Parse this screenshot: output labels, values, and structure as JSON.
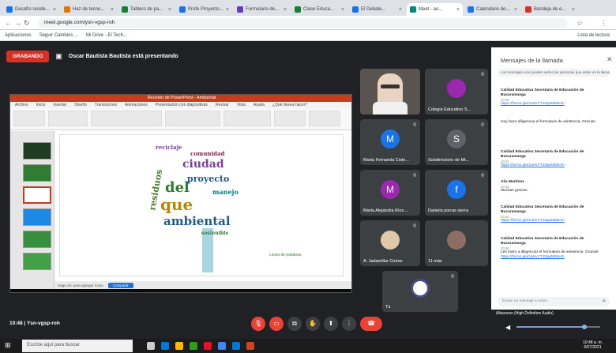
{
  "browser": {
    "tabs": [
      {
        "label": "Desafío reside...",
        "color": "#1a73e8"
      },
      {
        "label": "Haz de tecno...",
        "color": "#e37400"
      },
      {
        "label": "Tablero de pa...",
        "color": "#188038"
      },
      {
        "label": "Profe Proyecto...",
        "color": "#1a73e8"
      },
      {
        "label": "Formulario de...",
        "color": "#673ab7"
      },
      {
        "label": "Clase Educa...",
        "color": "#188038"
      },
      {
        "label": "El Debate...",
        "color": "#1a73e8"
      },
      {
        "label": "Meet - ao...",
        "color": "#00897b"
      },
      {
        "label": "Calendario de...",
        "color": "#1a73e8"
      },
      {
        "label": "Bandeja de e...",
        "color": "#d93025"
      }
    ],
    "url": "meet.google.com/ysn-vgsp-roh",
    "bookmarks": [
      "Aplicaciones",
      "Seguir Cambios ...",
      "Mi Drive - El Tech..."
    ],
    "reading_list": "Lista de lectura"
  },
  "meet": {
    "recording_label": "GRABANDO",
    "presenting_text": "Oscar Bautista Bautista está presentando",
    "meeting_code": "10:48 | Ysn-vgsp-roh",
    "slide": {
      "app_title": "Reunión de PowerPoint - Ambiental",
      "menu": [
        "Archivo",
        "Inicio",
        "Insertar",
        "Diseño",
        "Transiciones",
        "Animaciones",
        "Presentación con diapositivas",
        "Revisar",
        "Vista",
        "Ayuda",
        "¿Qué desea hacer?"
      ],
      "cloud_words": [
        {
          "text": "ciudad",
          "color": "#7b3f9e"
        },
        {
          "text": "proyecto",
          "color": "#1e5a8c"
        },
        {
          "text": "del",
          "color": "#2e7d32"
        },
        {
          "text": "que",
          "color": "#b8860b"
        },
        {
          "text": "ambiental",
          "color": "#1e5a8c"
        },
        {
          "text": "residuos",
          "color": "#4a7c2f"
        },
        {
          "text": "comunidad",
          "color": "#8b2252"
        },
        {
          "text": "sostenible",
          "color": "#2e7d32"
        },
        {
          "text": "manejo",
          "color": "#00838f"
        },
        {
          "text": "reciclaje",
          "color": "#7b3f9e"
        }
      ],
      "caption": "Lluvia de palabras",
      "status_notes": "Haga clic para agregar notas",
      "status_button": "Compartir"
    },
    "participants": [
      {
        "name": "Colegio Educativo S...",
        "initial": "",
        "color": "#9c27b0"
      },
      {
        "name": "Marta Fernanda Ciste...",
        "initial": "M",
        "color": "#1a73e8"
      },
      {
        "name": "Subdirectorio de Mt...",
        "initial": "S",
        "color": "#5f6368"
      },
      {
        "name": "Marta Alejandra Ríos ...",
        "initial": "M",
        "color": "#9c27b0"
      },
      {
        "name": "Daniela porras sierra",
        "initial": "f",
        "color": "#1a73e8"
      },
      {
        "name": "A. Jadamillar Cortes",
        "initial": "",
        "color": "#c49a6c"
      },
      {
        "name": "11 más",
        "initial": "",
        "color": "#8d6e63"
      },
      {
        "name": "Tú",
        "initial": "",
        "color": "#ffffff"
      }
    ],
    "chat": {
      "title": "Mensajes de la llamada",
      "notice": "Los mensajes solo pueden verlos las personas que están en la llamada",
      "messages": [
        {
          "sender": "Calidad Educativa Secretaría de Educación de Bucaramanga",
          "time": "10:40",
          "text": "",
          "link": "https://forms.gle/1aHvYTJ3qwMbbHm"
        },
        {
          "sender": "",
          "time": "",
          "text": "Hoy favor diligenciar el formulario de asistencia. Gracias",
          "link": ""
        },
        {
          "sender": "Calidad Educativa Secretaría de Educación de Bucaramanga",
          "time": "10:41",
          "text": "",
          "link": "https://forms.gle/1aHvYTJ3qwMbbHm"
        },
        {
          "sender": "Alix Martínez",
          "time": "10:42",
          "text": "Muchas gracias",
          "link": ""
        },
        {
          "sender": "Calidad Educativa Secretaría de Educación de Bucaramanga",
          "time": "10:44",
          "text": "",
          "link": "https://forms.gle/1aHvYTJ3qwMbbHm"
        },
        {
          "sender": "Calidad Educativa Secretaría de Educación de Bucaramanga",
          "time": "10:46",
          "text": "Les invito a diligenciar el formulario de asistencia. Gracias",
          "link": "https://forms.gle/1aHvYTJ3qwMbbHm"
        }
      ],
      "input_placeholder": "Enviar un mensaje a todos"
    },
    "audio_label": "Altavoces (High Definition Audio)",
    "colors": {
      "end_call": "#ea4335",
      "mic_off": "#ea4335",
      "accent": "#1a73e8"
    }
  },
  "taskbar": {
    "search_placeholder": "Escribe aquí para buscar",
    "clock_time": "10:48 a. m.",
    "clock_date": "6/07/2021"
  }
}
